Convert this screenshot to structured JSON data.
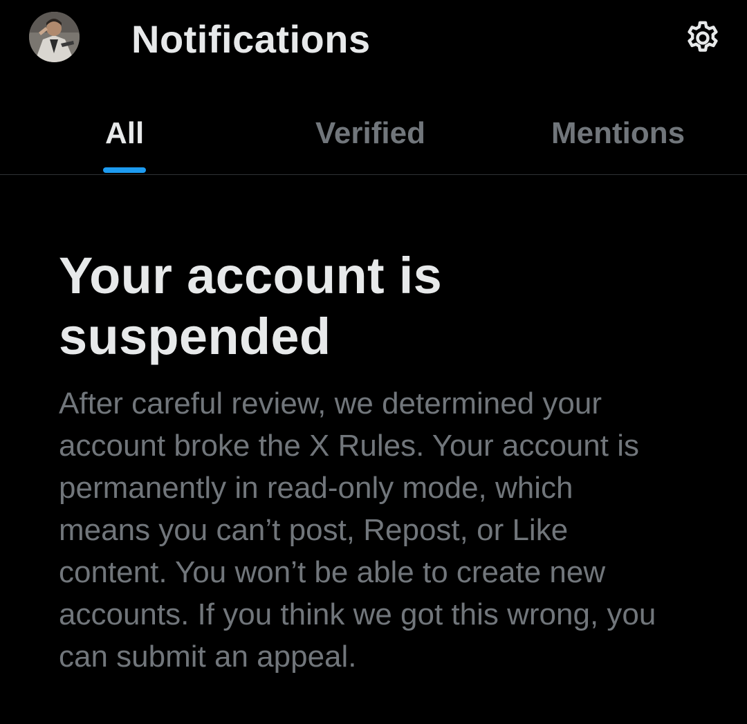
{
  "header": {
    "avatar_icon": "user-avatar",
    "title": "Notifications",
    "settings_icon": "gear-icon"
  },
  "tabs": [
    {
      "label": "All",
      "active": true
    },
    {
      "label": "Verified",
      "active": false
    },
    {
      "label": "Mentions",
      "active": false
    }
  ],
  "notice": {
    "headline": "Your account is suspended",
    "body": "After careful review, we determined your account broke the X Rules. Your account is permanently in read-only mode, which means you can’t post, Repost, or Like content. You won’t be able to create new accounts. If you think we got this wrong, you can submit an appeal."
  },
  "colors": {
    "background": "#000000",
    "primary_text": "#e7e9ea",
    "secondary_text": "#71767b",
    "accent": "#1d9bf0",
    "divider": "#2f3336"
  }
}
